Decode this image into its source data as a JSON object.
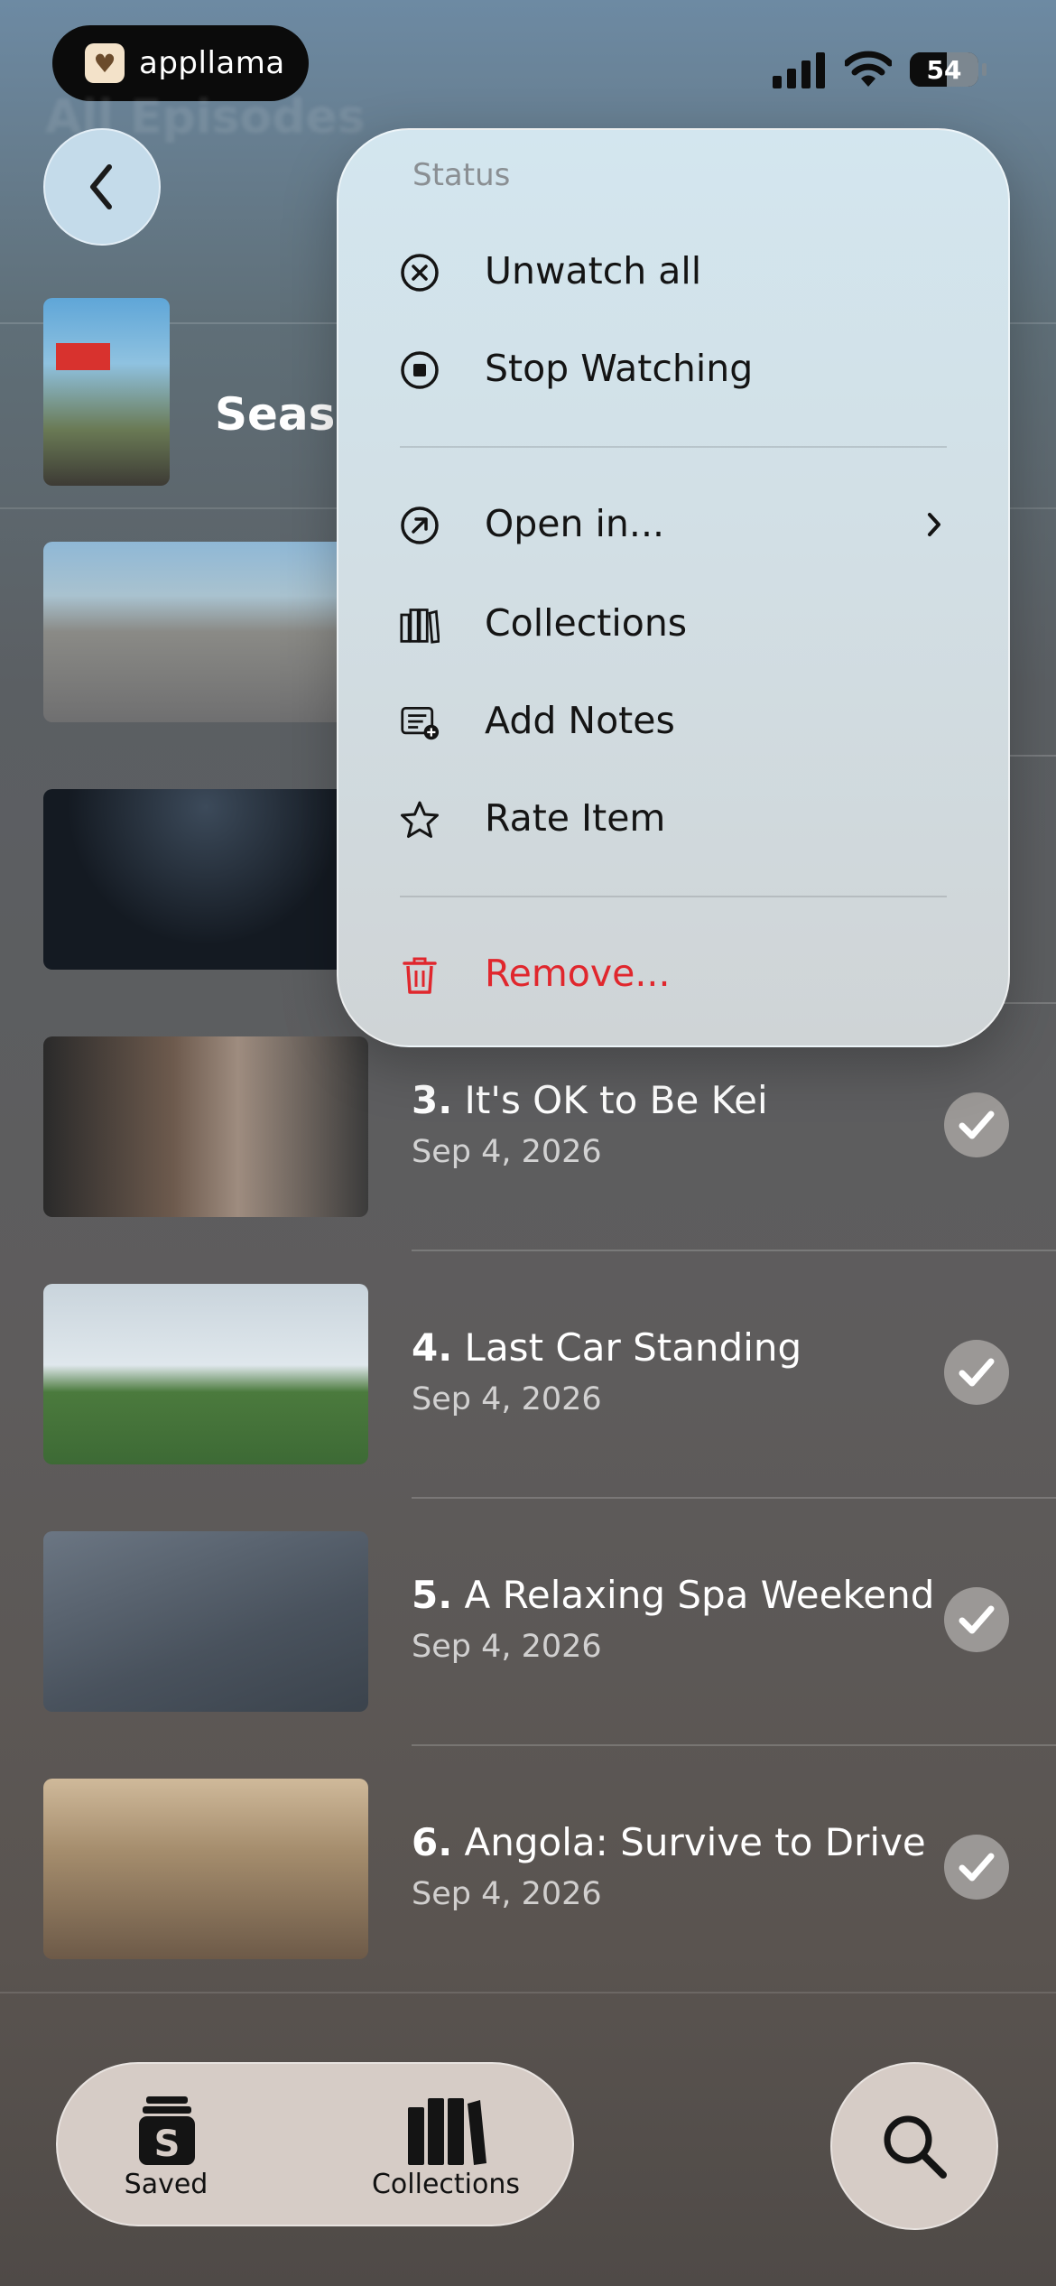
{
  "status_bar": {
    "brand_name": "appllama",
    "battery_level": "54",
    "battery_fraction": 0.54
  },
  "header": {
    "title": "All Episodes",
    "back_icon": "chevron-left-icon"
  },
  "season": {
    "label": "Seaso"
  },
  "context_menu": {
    "section_title": "Status",
    "items": [
      {
        "label": "Unwatch all",
        "icon": "x-circle-icon"
      },
      {
        "label": "Stop Watching",
        "icon": "stop-circle-icon"
      },
      {
        "label": "Open in...",
        "icon": "arrow-up-right-circle-icon",
        "has_submenu": true
      },
      {
        "label": "Collections",
        "icon": "books-icon"
      },
      {
        "label": "Add Notes",
        "icon": "note-add-icon"
      },
      {
        "label": "Rate Item",
        "icon": "star-icon"
      },
      {
        "label": "Remove...",
        "icon": "trash-icon",
        "destructive": true
      }
    ],
    "destructive_color": "#e0272d"
  },
  "episodes": [
    {
      "number": "3.",
      "title": "It's OK to Be Kei",
      "date": "Sep 4, 2026",
      "watched": true
    },
    {
      "number": "4.",
      "title": "Last Car Standing",
      "date": "Sep 4, 2026",
      "watched": true
    },
    {
      "number": "5.",
      "title": "A Relaxing Spa Weekend",
      "date": "Sep 4, 2026",
      "watched": true
    },
    {
      "number": "6.",
      "title": "Angola: Survive to Drive",
      "date": "Sep 4, 2026",
      "watched": true
    }
  ],
  "tab_bar": {
    "tabs": [
      {
        "label": "Saved",
        "icon": "saved-bag-icon"
      },
      {
        "label": "Collections",
        "icon": "books-icon"
      }
    ],
    "search_icon": "search-icon"
  }
}
